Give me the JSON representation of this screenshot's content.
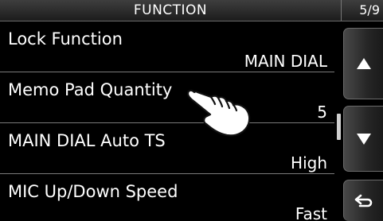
{
  "header": {
    "title": "FUNCTION",
    "page": "5/9"
  },
  "menu": {
    "items": [
      {
        "label": "Lock Function",
        "value": "MAIN DIAL"
      },
      {
        "label": "Memo Pad Quantity",
        "value": "5"
      },
      {
        "label": "MAIN DIAL Auto TS",
        "value": "High"
      },
      {
        "label": "MIC Up/Down Speed",
        "value": "Fast"
      }
    ]
  },
  "scroll": {
    "position_fraction": 0.5
  },
  "side_buttons": {
    "up_icon": "up-triangle-icon",
    "down_icon": "down-triangle-icon",
    "back_icon": "return-arrow-icon"
  },
  "pointer": {
    "icon": "pointing-hand-icon",
    "target": "Memo Pad Quantity"
  }
}
